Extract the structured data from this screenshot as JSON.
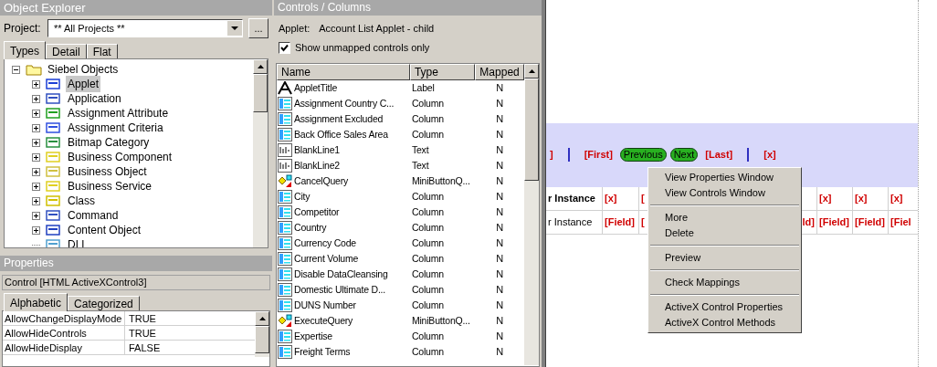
{
  "object_explorer": {
    "title": "Object Explorer",
    "project_label": "Project:",
    "project_value": "** All Projects **",
    "browse_button": "...",
    "tabs": [
      {
        "label": "Types",
        "selected": true
      },
      {
        "label": "Detail",
        "selected": false
      },
      {
        "label": "Flat",
        "selected": false
      }
    ],
    "tree": {
      "label": "Siebel Objects",
      "expanded": true,
      "children": [
        {
          "label": "Applet",
          "expandable": true,
          "selected": true
        },
        {
          "label": "Application",
          "expandable": true,
          "selected": false
        },
        {
          "label": "Assignment Attribute",
          "expandable": true,
          "selected": false
        },
        {
          "label": "Assignment Criteria",
          "expandable": true,
          "selected": false
        },
        {
          "label": "Bitmap Category",
          "expandable": true,
          "selected": false
        },
        {
          "label": "Business Component",
          "expandable": true,
          "selected": false
        },
        {
          "label": "Business Object",
          "expandable": true,
          "selected": false
        },
        {
          "label": "Business Service",
          "expandable": true,
          "selected": false
        },
        {
          "label": "Class",
          "expandable": true,
          "selected": false
        },
        {
          "label": "Command",
          "expandable": true,
          "selected": false
        },
        {
          "label": "Content Object",
          "expandable": true,
          "selected": false
        },
        {
          "label": "DLL",
          "expandable": false,
          "selected": false
        }
      ]
    }
  },
  "properties": {
    "title": "Properties",
    "object": "Control [HTML ActiveXControl3]",
    "tabs": [
      {
        "label": "Alphabetic",
        "selected": true
      },
      {
        "label": "Categorized",
        "selected": false
      }
    ],
    "rows": [
      {
        "name": "AllowChangeDisplayMode",
        "value": "TRUE"
      },
      {
        "name": "AllowHideControls",
        "value": "TRUE"
      },
      {
        "name": "AllowHideDisplay",
        "value": "FALSE"
      }
    ]
  },
  "controls": {
    "title": "Controls / Columns",
    "applet_label": "Applet:",
    "applet_value": "Account List Applet - child",
    "unmapped_only": {
      "label": "Show unmapped controls only",
      "checked": true
    },
    "columns": [
      "Name",
      "Type",
      "Mapped"
    ],
    "rows": [
      {
        "kind": "label",
        "name": "AppletTitle",
        "type": "Label",
        "mapped": "N"
      },
      {
        "kind": "column",
        "name": "Assignment Country C...",
        "type": "Column",
        "mapped": "N"
      },
      {
        "kind": "column",
        "name": "Assignment Excluded",
        "type": "Column",
        "mapped": "N"
      },
      {
        "kind": "column",
        "name": "Back Office Sales Area",
        "type": "Column",
        "mapped": "N"
      },
      {
        "kind": "text",
        "name": "BlankLine1",
        "type": "Text",
        "mapped": "N"
      },
      {
        "kind": "text",
        "name": "BlankLine2",
        "type": "Text",
        "mapped": "N"
      },
      {
        "kind": "button",
        "name": "CancelQuery",
        "type": "MiniButtonQ...",
        "mapped": "N"
      },
      {
        "kind": "column",
        "name": "City",
        "type": "Column",
        "mapped": "N"
      },
      {
        "kind": "column",
        "name": "Competitor",
        "type": "Column",
        "mapped": "N"
      },
      {
        "kind": "column",
        "name": "Country",
        "type": "Column",
        "mapped": "N"
      },
      {
        "kind": "column",
        "name": "Currency Code",
        "type": "Column",
        "mapped": "N"
      },
      {
        "kind": "column",
        "name": "Current Volume",
        "type": "Column",
        "mapped": "N"
      },
      {
        "kind": "column",
        "name": "Disable DataCleansing",
        "type": "Column",
        "mapped": "N"
      },
      {
        "kind": "column",
        "name": "Domestic Ultimate D...",
        "type": "Column",
        "mapped": "N"
      },
      {
        "kind": "column",
        "name": "DUNS Number",
        "type": "Column",
        "mapped": "N"
      },
      {
        "kind": "button",
        "name": "ExecuteQuery",
        "type": "MiniButtonQ...",
        "mapped": "N"
      },
      {
        "kind": "column",
        "name": "Expertise",
        "type": "Column",
        "mapped": "N"
      },
      {
        "kind": "column",
        "name": "Freight Terms",
        "type": "Column",
        "mapped": "N"
      }
    ]
  },
  "layout_canvas": {
    "nav": [
      {
        "kind": "link",
        "text": "]"
      },
      {
        "kind": "separator"
      },
      {
        "kind": "link",
        "text": "[First]"
      },
      {
        "kind": "button",
        "text": "Previous"
      },
      {
        "kind": "button",
        "text": "Next"
      },
      {
        "kind": "link",
        "text": "[Last]"
      },
      {
        "kind": "separator"
      },
      {
        "kind": "link",
        "text": "[x]"
      }
    ],
    "header_row": [
      "r Instance",
      "[x]",
      "[",
      "[x]",
      "[x]",
      "[x]"
    ],
    "data_row": [
      "r Instance",
      "[Field]",
      "[",
      "ld]",
      "[Field]",
      "[Field]",
      "[Fiel"
    ]
  },
  "context_menu": {
    "groups": [
      [
        "View Properties Window",
        "View Controls Window"
      ],
      [
        "More",
        "Delete"
      ],
      [
        "Preview"
      ],
      [
        "Check Mappings"
      ],
      [
        "ActiveX Control Properties",
        "ActiveX Control Methods"
      ]
    ]
  }
}
